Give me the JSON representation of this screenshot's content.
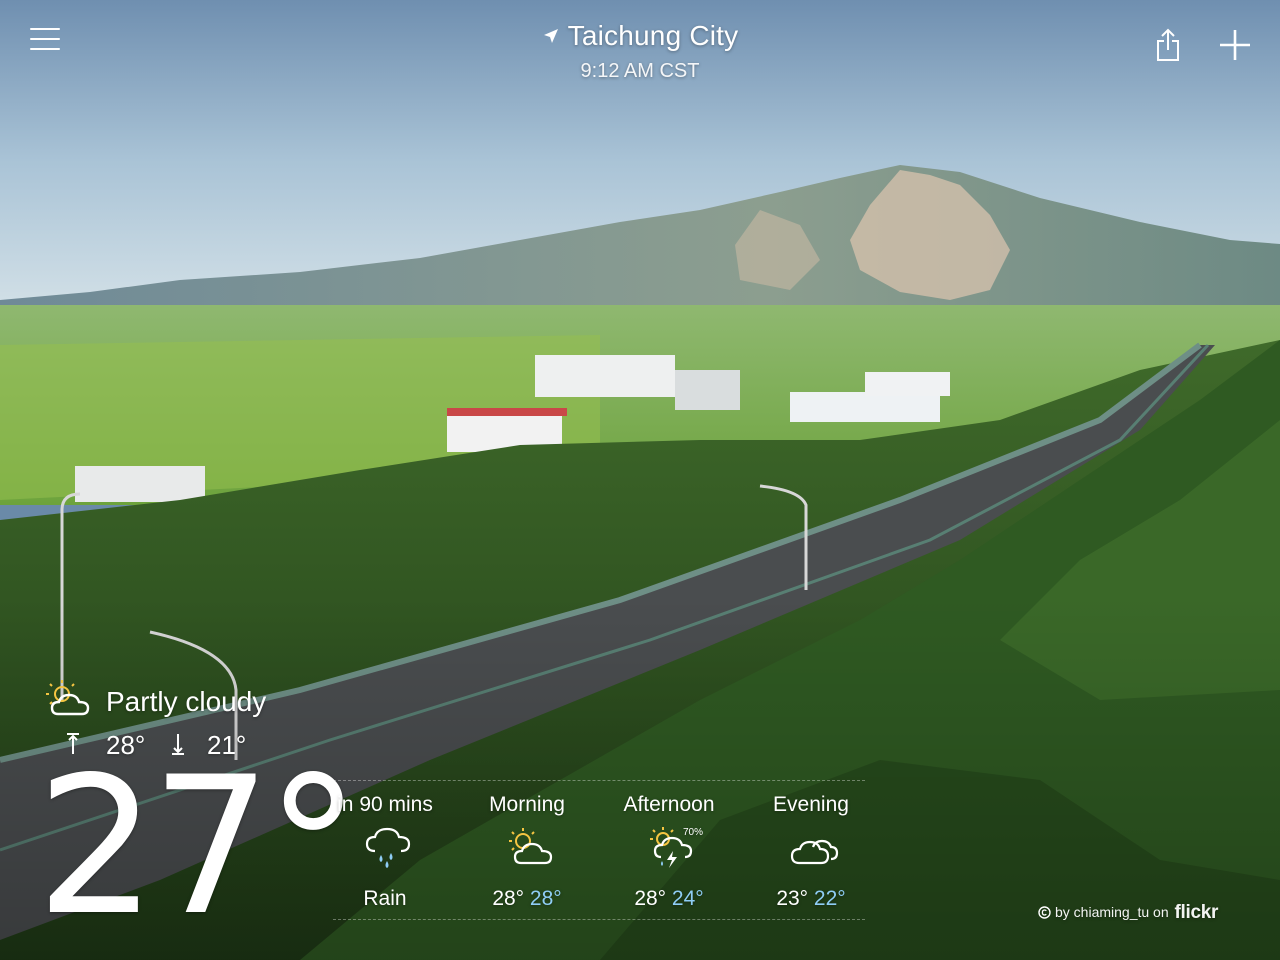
{
  "header": {
    "location": "Taichung City",
    "time": "9:12 AM CST"
  },
  "current": {
    "condition": "Partly cloudy",
    "high": "28°",
    "low": "21°",
    "temperature": "27°",
    "icon": "partly-cloudy-icon"
  },
  "forecast": [
    {
      "label": "in 90 mins",
      "condition": "Rain",
      "icon": "rain-icon"
    },
    {
      "label": "Morning",
      "high": "28°",
      "low": "28°",
      "icon": "partly-sunny-icon"
    },
    {
      "label": "Afternoon",
      "high": "28°",
      "low": "24°",
      "probability": "70%",
      "icon": "thunderstorm-icon"
    },
    {
      "label": "Evening",
      "high": "23°",
      "low": "22°",
      "icon": "cloudy-icon"
    }
  ],
  "attribution": {
    "by": "by chiaming_tu on",
    "brand": "flickr"
  },
  "colors": {
    "low_temp": "#8fcdf5",
    "sun": "#f5c542"
  }
}
